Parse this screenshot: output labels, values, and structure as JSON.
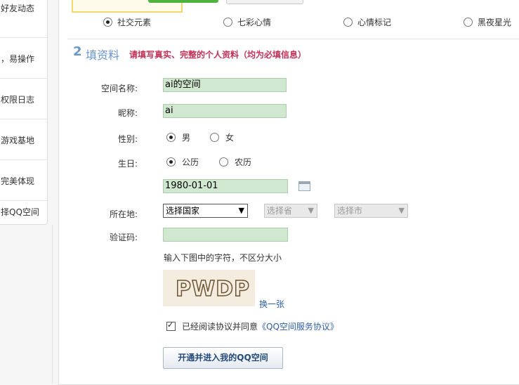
{
  "sidebar": {
    "items": [
      {
        "label": "好友动态"
      },
      {
        "label": "，易操作"
      },
      {
        "label": "权限日志"
      },
      {
        "label": "游戏基地"
      },
      {
        "label": "完美体现"
      },
      {
        "label": "择QQ空间"
      }
    ]
  },
  "themes": {
    "options": [
      {
        "label": "社交元素",
        "selected": true
      },
      {
        "label": "七彩心情",
        "selected": false
      },
      {
        "label": "心情标记",
        "selected": false
      },
      {
        "label": "黑夜星光",
        "selected": false
      }
    ]
  },
  "step": {
    "number": "2",
    "title": "填资料",
    "hint": "请填写真实、完整的个人资料（均为必填信息）"
  },
  "form": {
    "space_name": {
      "label": "空间名称:",
      "value": "ai的空间"
    },
    "nickname": {
      "label": "昵称:",
      "value": "ai"
    },
    "gender": {
      "label": "性别:",
      "options": [
        "男",
        "女"
      ],
      "selected": "男"
    },
    "birthday": {
      "label": "生日:",
      "options": [
        "公历",
        "农历"
      ],
      "selected": "公历",
      "date": "1980-01-01"
    },
    "location": {
      "label": "所在地:",
      "country": "选择国家",
      "province": "选择省",
      "city": "选择市"
    },
    "captcha": {
      "label": "验证码:",
      "value": "",
      "hint": "输入下图中的字符，不区分大小",
      "image_text": "PWDP",
      "refresh_label": "换一张"
    },
    "agreement": {
      "checked": true,
      "text": "已经阅读协议并同意",
      "link": "《QQ空间服务协议》"
    },
    "submit_label": "开通并进入我的QQ空间"
  },
  "colors": {
    "field_bg": "#cfe8cf",
    "step_blue": "#6b96c9",
    "hint_red": "#c33158",
    "link_blue": "#2f5fa5"
  }
}
